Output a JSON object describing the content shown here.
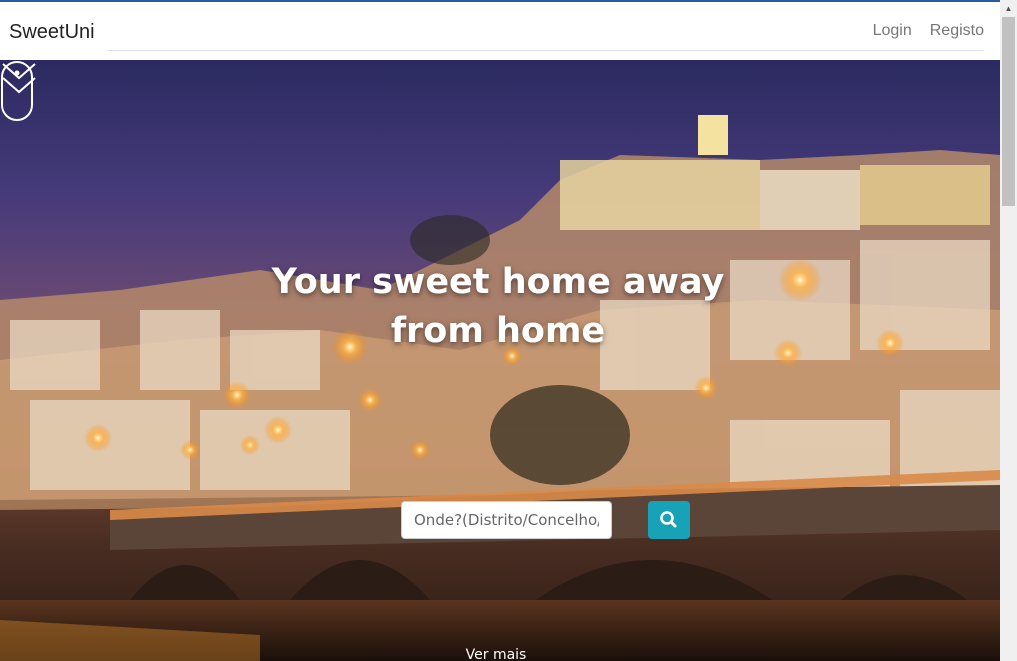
{
  "navbar": {
    "brand": "SweetUni",
    "login_label": "Login",
    "register_label": "Registo"
  },
  "hero": {
    "headline_line1": "Your sweet home away",
    "headline_line2": "from home",
    "search": {
      "placeholder": "Onde?(Distrito/Concelho/I",
      "button_icon": "search-icon"
    },
    "scroll_hint": "Ver mais",
    "scroll_icons": [
      "mouse-icon",
      "chevron-down-icon"
    ]
  },
  "colors": {
    "search_button": "#17a2b8",
    "top_accent": "#2a5aa0"
  }
}
